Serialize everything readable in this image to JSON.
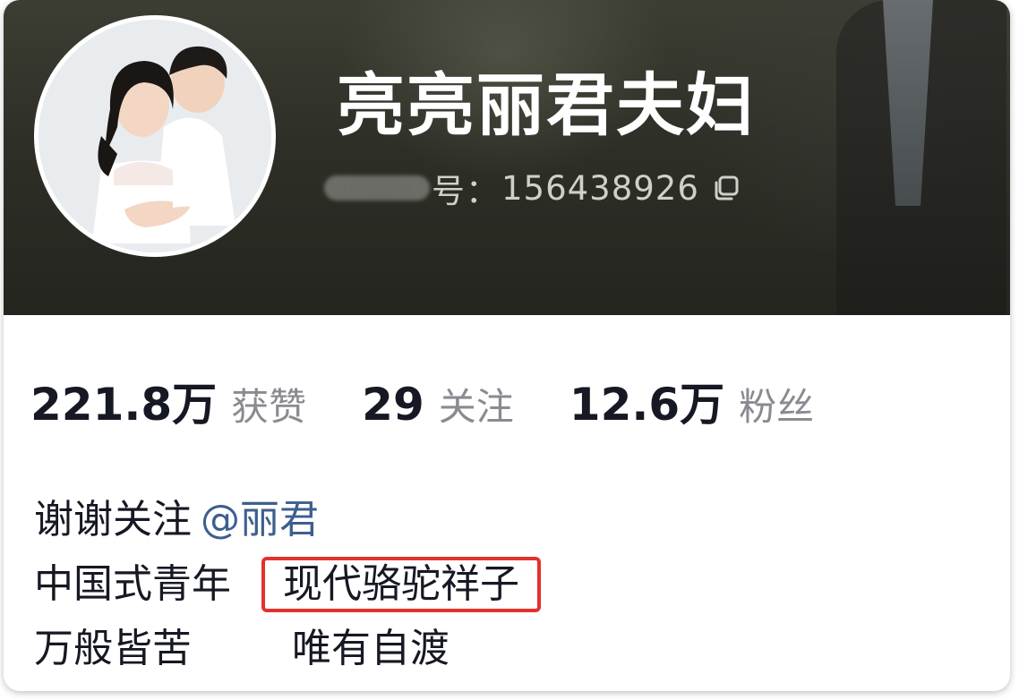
{
  "profile": {
    "nickname": "亮亮丽君夫妇",
    "id_label": "号：",
    "id_number": "156438926"
  },
  "stats": [
    {
      "value": "221.8万",
      "label": "获赞"
    },
    {
      "value": "29",
      "label": "关注"
    },
    {
      "value": "12.6万",
      "label": "粉丝"
    }
  ],
  "bio": {
    "line1_text": "谢谢关注",
    "line1_mention": "@丽君",
    "line2_left": "中国式青年",
    "line2_highlight": "现代骆驼祥子",
    "line3_left": "万般皆苦",
    "line3_right": "唯有自渡"
  },
  "colors": {
    "highlight_border": "#e3322d",
    "mention": "#3d5f8f",
    "primary_text": "#161823",
    "secondary_text": "#8a8b91"
  },
  "icons": {
    "copy": "copy-icon"
  }
}
